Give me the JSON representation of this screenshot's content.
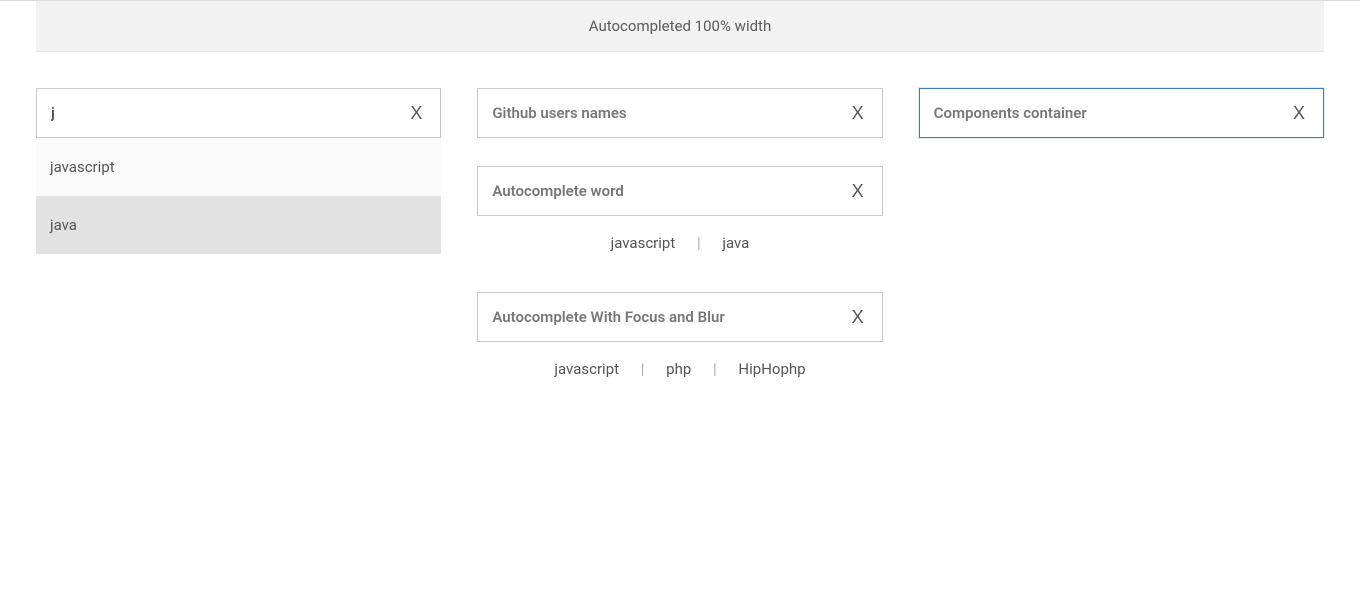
{
  "header": {
    "title": "Autocompleted 100% width"
  },
  "col1": {
    "input_value": "j",
    "clear": "X",
    "suggestions": [
      "javascript",
      "java"
    ],
    "highlight_index": 1
  },
  "col2": {
    "github": {
      "placeholder": "Github users names",
      "clear": "X"
    },
    "word": {
      "placeholder": "Autocomplete word",
      "clear": "X",
      "tags": [
        "javascript",
        "java"
      ]
    },
    "focusblur": {
      "placeholder": "Autocomplete With Focus and Blur",
      "clear": "X",
      "tags": [
        "javascript",
        "php",
        "HipHophp"
      ]
    }
  },
  "col3": {
    "placeholder": "Components container",
    "clear": "X"
  },
  "separator": "|"
}
